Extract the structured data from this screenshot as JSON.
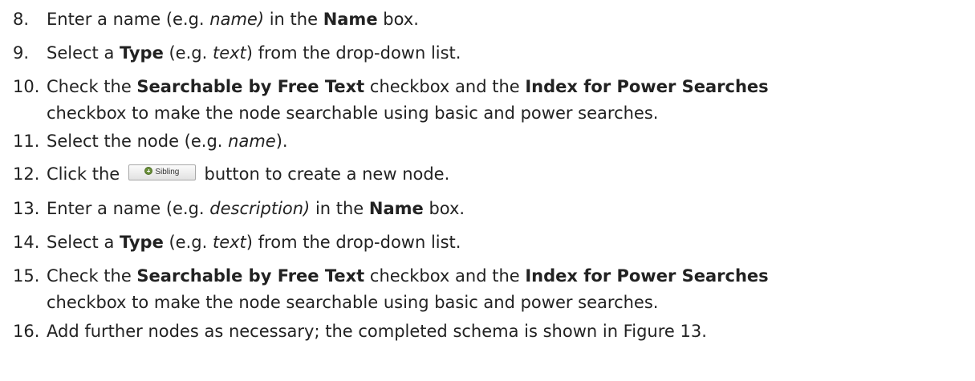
{
  "steps": [
    {
      "num": "8.",
      "parts": [
        {
          "t": "Enter a name (e.g. "
        },
        {
          "t": "name)",
          "s": "i"
        },
        {
          "t": " in the "
        },
        {
          "t": "Name",
          "s": "b"
        },
        {
          "t": " box."
        }
      ]
    },
    {
      "num": "9.",
      "parts": [
        {
          "t": "Select a "
        },
        {
          "t": "Type",
          "s": "b"
        },
        {
          "t": " (e.g. "
        },
        {
          "t": "text",
          "s": "i"
        },
        {
          "t": ") from the drop-down list."
        }
      ]
    },
    {
      "num": "10.",
      "parts": [
        {
          "t": "Check the "
        },
        {
          "t": "Searchable by Free Text",
          "s": "b"
        },
        {
          "t": " checkbox and the "
        },
        {
          "t": "Index for Power Searches",
          "s": "b"
        }
      ],
      "cont": "checkbox to make the node searchable using basic and power searches."
    },
    {
      "num": "11.",
      "parts": [
        {
          "t": "Select the node (e.g. "
        },
        {
          "t": "name",
          "s": "i"
        },
        {
          "t": ")."
        }
      ]
    },
    {
      "num": "12.",
      "parts": [
        {
          "t": "Click the "
        },
        {
          "btn": true
        },
        {
          "t": " button to create a new node."
        }
      ]
    },
    {
      "num": "13.",
      "parts": [
        {
          "t": "Enter a name (e.g. "
        },
        {
          "t": "description)",
          "s": "i"
        },
        {
          "t": " in the "
        },
        {
          "t": "Name",
          "s": "b"
        },
        {
          "t": " box."
        }
      ]
    },
    {
      "num": "14.",
      "parts": [
        {
          "t": "Select a "
        },
        {
          "t": "Type",
          "s": "b"
        },
        {
          "t": " (e.g. "
        },
        {
          "t": "text",
          "s": "i"
        },
        {
          "t": ") from the drop-down list."
        }
      ]
    },
    {
      "num": "15.",
      "parts": [
        {
          "t": "Check the "
        },
        {
          "t": "Searchable by Free Text",
          "s": "b"
        },
        {
          "t": " checkbox and the "
        },
        {
          "t": "Index for Power Searches",
          "s": "b"
        }
      ],
      "cont": "checkbox to make the node searchable using basic and power searches."
    },
    {
      "num": "16.",
      "parts": [
        {
          "t": "Add further nodes as necessary; the completed schema is shown in Figure 13."
        }
      ]
    }
  ],
  "sibling_button": {
    "label": "Sibling",
    "icon": "plus-circle-icon"
  }
}
